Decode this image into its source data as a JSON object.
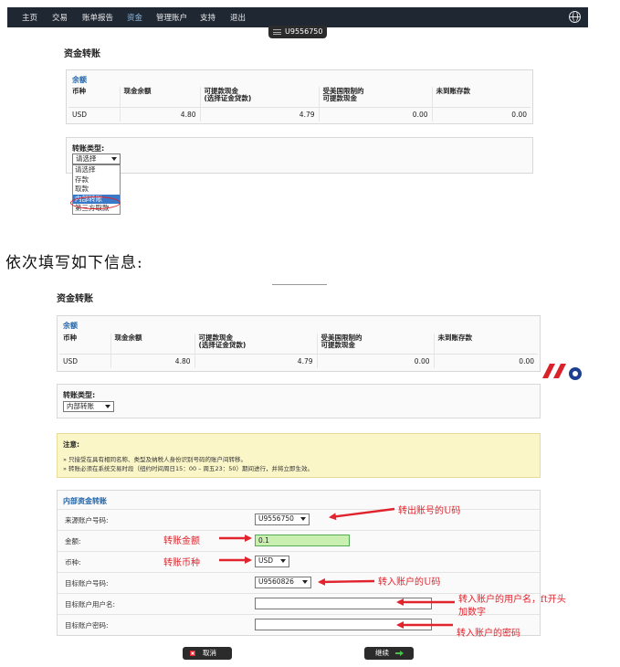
{
  "nav": {
    "items": [
      "主页",
      "交易",
      "账单报告",
      "资金",
      "管理账户",
      "支持",
      "退出"
    ],
    "active": "资金",
    "account_badge": "U9556750"
  },
  "top": {
    "title": "资金转账",
    "balance": {
      "section": "余额",
      "headers": [
        "币种",
        "现金余额",
        "可提款现金\n(选择证金贷款)",
        "受美国限制的\n可提款现金",
        "未到账存款"
      ],
      "row": [
        "USD",
        "4.80",
        "4.79",
        "0.00",
        "0.00"
      ]
    },
    "transfer_type_label": "转账类型:",
    "transfer_type_value": "请选择",
    "dropdown_options": [
      "请选择",
      "存款",
      "取款",
      "内部转账",
      "第三方取款"
    ],
    "highlighted_option": "内部转账"
  },
  "caption": "依次填写如下信息:",
  "bottom": {
    "title": "资金转账",
    "balance": {
      "section": "余额",
      "headers": [
        "币种",
        "现金余额",
        "可提款现金\n(选择证金贷款)",
        "受美国限制的\n可提款现金",
        "未到账存款"
      ],
      "row": [
        "USD",
        "4.80",
        "4.79",
        "0.00",
        "0.00"
      ]
    },
    "transfer_type_label": "转账类型:",
    "transfer_type_value": "内部转账",
    "notice": {
      "title": "注意:",
      "lines": [
        "» 只接受在具有相同名称、类型及纳税人身份识别号码的账户间转移。",
        "» 转账必须在系统交易时段（纽约时间周日15：00 – 周五23：50）期间进行，并将立即生效。"
      ]
    },
    "form": {
      "section": "内部资金转账",
      "source_label": "来源账户号码:",
      "source_value": "U9556750",
      "amount_label": "金额:",
      "amount_value": "0.1",
      "currency_label": "币种:",
      "currency_value": "USD",
      "target_label": "目标账户号码:",
      "target_value": "U9560826",
      "target_user_label": "目标账户用户名:",
      "target_user_value": "",
      "target_password_label": "目标账户密码:",
      "target_password_value": ""
    },
    "buttons": {
      "cancel": "取消",
      "continue": "继续"
    }
  },
  "annotations": {
    "out_account": "转出账号的U码",
    "amount": "转账金额",
    "currency": "转账币种",
    "in_account": "转入账户的U码",
    "in_user_1": "转入账户的用户名，ft开头",
    "in_user_2": "加数字",
    "in_password": "转入账户的密码"
  },
  "colors": {
    "nav_bg": "#1f2733",
    "link_blue": "#2266aa",
    "annotation_red": "#e0232c",
    "notice_bg": "#fbf6c8",
    "amount_field_bg": "#c9f0b0"
  },
  "icons": {
    "globe": "globe-icon",
    "menu": "menu-bars-icon",
    "cancel": "close-x-icon",
    "continue": "arrow-right-icon",
    "logo": "brand-logo-icon"
  }
}
